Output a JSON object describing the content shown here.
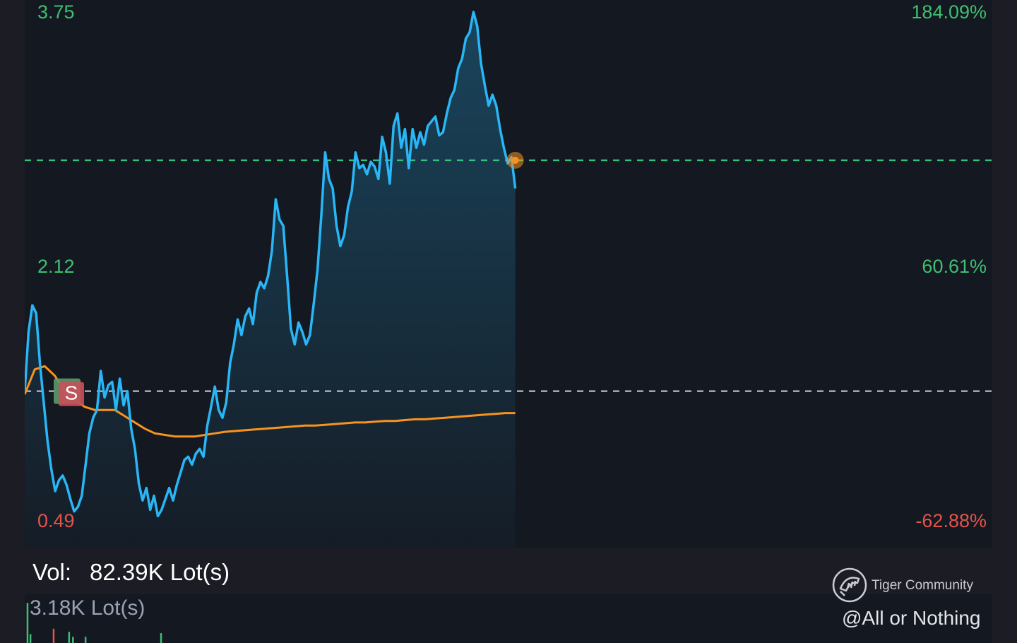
{
  "colors": {
    "price_line": "#29b6f6",
    "avg_line": "#f7931e",
    "positive": "#3fbf72",
    "negative": "#e5534b",
    "current_ref": "#2ec27e",
    "prev_close_ref": "#a8acc0",
    "marker_badge": "#c9505a",
    "marker_badge_back": "#5a9a6a"
  },
  "chart_data": {
    "type": "line",
    "y_range": [
      0.49,
      3.75
    ],
    "axis_left": {
      "top": "3.75",
      "mid": "2.12",
      "bottom": "0.49"
    },
    "axis_right": {
      "top": "184.09%",
      "mid": "60.61%",
      "bottom": "-62.88%"
    },
    "prev_close": 1.32,
    "current_price": 2.8,
    "session_progress": 0.507,
    "marker": {
      "label": "S",
      "x_fraction": 0.046,
      "price": 1.32
    },
    "series": [
      {
        "values": [
          1.32,
          1.7,
          1.87,
          1.82,
          1.5,
          1.25,
          1.0,
          0.82,
          0.68,
          0.75,
          0.78,
          0.72,
          0.63,
          0.55,
          0.58,
          0.65,
          0.85,
          1.05,
          1.15,
          1.2,
          1.45,
          1.28,
          1.36,
          1.38,
          1.2,
          1.4,
          1.23,
          1.32,
          1.08,
          0.95,
          0.73,
          0.62,
          0.7,
          0.56,
          0.65,
          0.52,
          0.56,
          0.63,
          0.7,
          0.62,
          0.72,
          0.8,
          0.88,
          0.9,
          0.85,
          0.92,
          0.95,
          0.9,
          1.1,
          1.22,
          1.35,
          1.2,
          1.15,
          1.25,
          1.5,
          1.62,
          1.78,
          1.68,
          1.8,
          1.85,
          1.75,
          1.95,
          2.02,
          1.98,
          2.06,
          2.22,
          2.55,
          2.42,
          2.38,
          2.06,
          1.72,
          1.62,
          1.76,
          1.7,
          1.62,
          1.68,
          1.88,
          2.1,
          2.45,
          2.85,
          2.68,
          2.62,
          2.38,
          2.25,
          2.32,
          2.5,
          2.6,
          2.85,
          2.75,
          2.77,
          2.71,
          2.79,
          2.76,
          2.68,
          2.95,
          2.85,
          2.65,
          3.02,
          3.1,
          2.88,
          3.0,
          2.75,
          3.0,
          2.88,
          2.98,
          2.9,
          3.02,
          3.05,
          3.08,
          2.96,
          2.98,
          3.1,
          3.2,
          3.25,
          3.39,
          3.45,
          3.58,
          3.62,
          3.75,
          3.66,
          3.42,
          3.28,
          3.15,
          3.22,
          3.15,
          3.0,
          2.88,
          2.78,
          2.82,
          2.62
        ],
        "color_key": "price_line"
      },
      {
        "values": [
          1.3,
          1.46,
          1.48,
          1.42,
          1.32,
          1.26,
          1.22,
          1.2,
          1.2,
          1.2,
          1.16,
          1.12,
          1.08,
          1.05,
          1.04,
          1.03,
          1.03,
          1.03,
          1.04,
          1.05,
          1.06,
          1.065,
          1.07,
          1.075,
          1.08,
          1.085,
          1.09,
          1.095,
          1.1,
          1.1,
          1.105,
          1.11,
          1.115,
          1.12,
          1.12,
          1.125,
          1.13,
          1.13,
          1.135,
          1.14,
          1.14,
          1.145,
          1.15,
          1.155,
          1.16,
          1.165,
          1.17,
          1.175,
          1.18,
          1.18
        ],
        "color_key": "avg_line"
      }
    ]
  },
  "volume": {
    "label": "Vol:",
    "value": "82.39K Lot(s)",
    "max_label": "3.18K Lot(s)",
    "bars": [
      {
        "x": 0.002,
        "v": 0.9,
        "c": "pos"
      },
      {
        "x": 0.005,
        "v": 0.2,
        "c": "pos"
      },
      {
        "x": 0.029,
        "v": 0.32,
        "c": "neg"
      },
      {
        "x": 0.045,
        "v": 0.25,
        "c": "pos"
      },
      {
        "x": 0.049,
        "v": 0.14,
        "c": "pos"
      },
      {
        "x": 0.062,
        "v": 0.14,
        "c": "pos"
      },
      {
        "x": 0.14,
        "v": 0.22,
        "c": "pos"
      }
    ]
  },
  "watermark": {
    "community": "Tiger Community",
    "user": "@All or Nothing"
  }
}
